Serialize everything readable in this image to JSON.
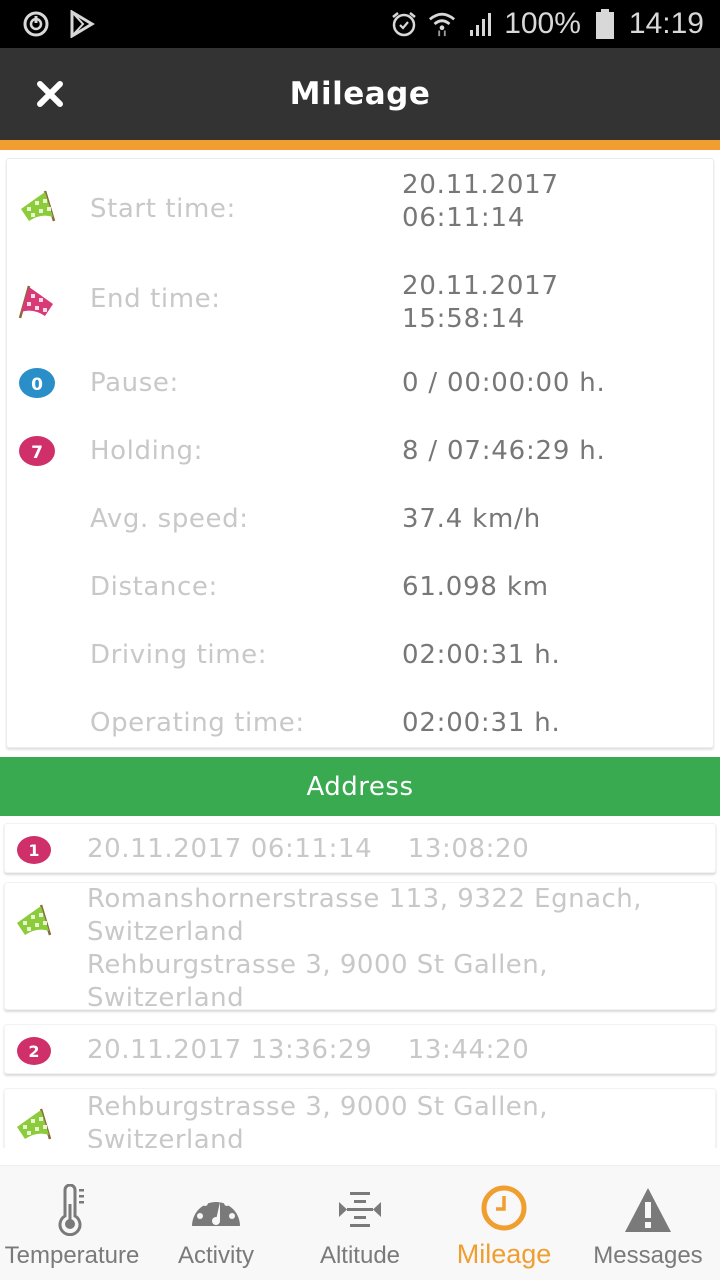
{
  "status_bar": {
    "battery": "100%",
    "time": "14:19",
    "icons": [
      "sync-icon",
      "play-store-icon",
      "alarm-icon",
      "wifi-icon",
      "signal-icon",
      "battery-icon"
    ]
  },
  "app_bar": {
    "title": "Mileage",
    "close_icon": "close-icon"
  },
  "colors": {
    "accent": "#f09e30",
    "app_bar": "#333333",
    "section_header": "#3aaa50",
    "label": "#c8c8c8",
    "value": "#777777",
    "pause_badge": "#2a8fc8",
    "holding_badge": "#d0306a"
  },
  "summary": {
    "rows": [
      {
        "icon": "green-checkered-flag-icon",
        "label": "Start time:",
        "value_line1": "20.11.2017",
        "value_line2": "06:11:14"
      },
      {
        "icon": "red-checkered-flag-icon",
        "label": "End time:",
        "value_line1": "20.11.2017",
        "value_line2": "15:58:14"
      },
      {
        "icon": "pause-badge-icon",
        "badge": "0",
        "label": "Pause:",
        "value_line1": "0 / 00:00:00 h."
      },
      {
        "icon": "holding-badge-icon",
        "badge": "7",
        "label": "Holding:",
        "value_line1": "8 / 07:46:29 h."
      },
      {
        "label": "Avg. speed:",
        "value_line1": "37.4 km/h"
      },
      {
        "label": "Distance:",
        "value_line1": "61.098 km"
      },
      {
        "label": "Driving time:",
        "value_line1": "02:00:31 h."
      },
      {
        "label": "Operating time:",
        "value_line1": "02:00:31 h."
      }
    ]
  },
  "address_section": {
    "title": "Address",
    "entries": [
      {
        "badge": "1",
        "header": "20.11.2017 06:11:14    13:08:20",
        "lines": [
          "Romanshornerstrasse 113, 9322 Egnach,",
          "Switzerland",
          "Rehburgstrasse 3, 9000 St Gallen,",
          "Switzerland"
        ]
      },
      {
        "badge": "2",
        "header": "20.11.2017 13:36:29    13:44:20",
        "lines": [
          "Rehburgstrasse 3, 9000 St Gallen,",
          "Switzerland"
        ]
      }
    ]
  },
  "bottom_nav": {
    "active": "Mileage",
    "items": [
      {
        "label": "Temperature",
        "icon": "thermometer-icon"
      },
      {
        "label": "Activity",
        "icon": "speedometer-icon"
      },
      {
        "label": "Altitude",
        "icon": "altitude-icon"
      },
      {
        "label": "Mileage",
        "icon": "clock-icon"
      },
      {
        "label": "Messages",
        "icon": "warning-icon"
      }
    ]
  }
}
